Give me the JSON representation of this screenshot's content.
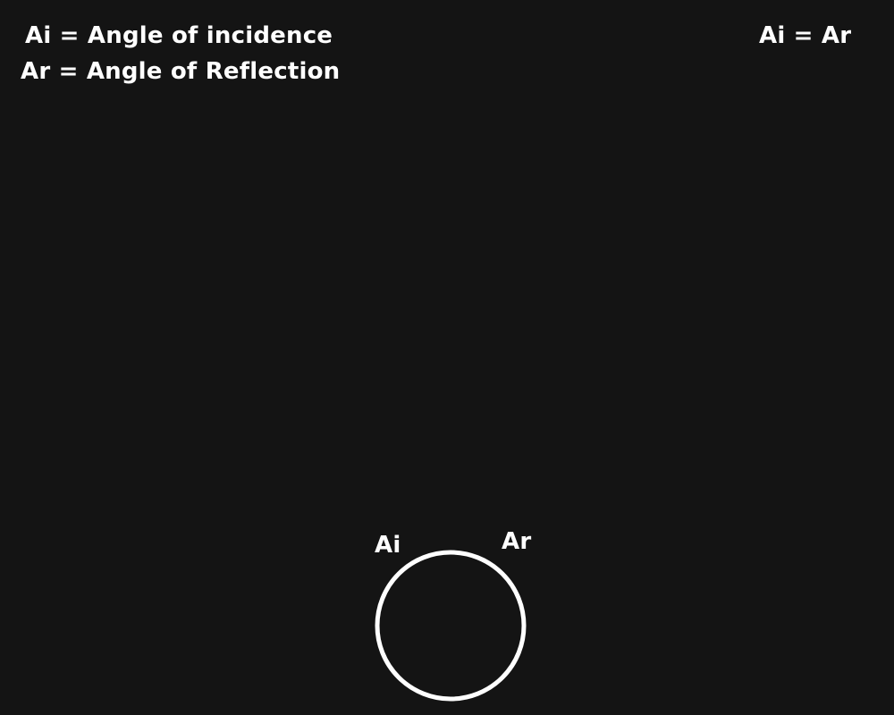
{
  "legend": {
    "line1": "Ai = Angle of incidence",
    "line2": "Ar = Angle of Reflection"
  },
  "relation": "Ai = Ar",
  "diagram": {
    "label_ai": "Ai",
    "label_ar": "Ar",
    "stroke_color": "#ffffff",
    "background_color": "#141414"
  }
}
